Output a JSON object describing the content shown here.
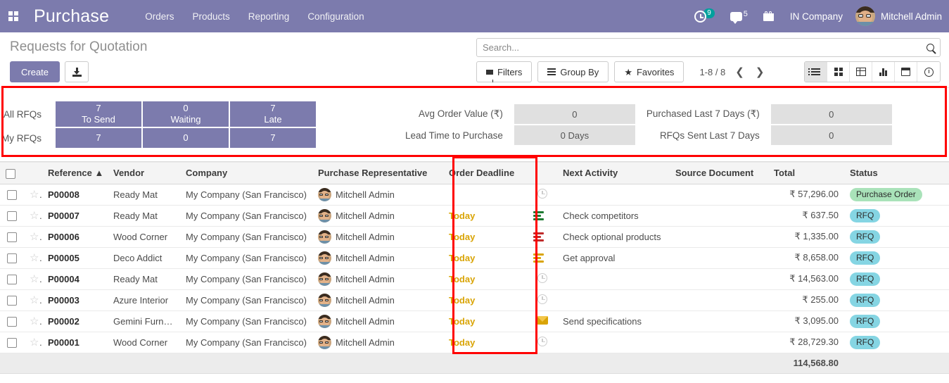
{
  "navbar": {
    "apps_icon": "apps-grid-icon",
    "brand": "Purchase",
    "menu": [
      "Orders",
      "Products",
      "Reporting",
      "Configuration"
    ],
    "activity_icon": "clock-icon",
    "activity_count": "9",
    "messages_icon": "chat-icon",
    "messages_count": "5",
    "gift_icon": "gift-icon",
    "company": "IN Company",
    "user": "Mitchell Admin"
  },
  "control_panel": {
    "title": "Requests for Quotation",
    "create_label": "Create",
    "import_icon": "download-icon",
    "search": {
      "value": "",
      "placeholder": "Search...",
      "icon": "search-icon"
    },
    "filters_label": "Filters",
    "group_by_label": "Group By",
    "favorites_label": "Favorites",
    "pager": "1-8 / 8",
    "prev_icon": "chevron-left-icon",
    "next_icon": "chevron-right-icon",
    "views": [
      {
        "name": "list",
        "icon": "list-view-icon",
        "active": true
      },
      {
        "name": "kanban",
        "icon": "kanban-view-icon",
        "active": false
      },
      {
        "name": "pivot",
        "icon": "pivot-view-icon",
        "active": false
      },
      {
        "name": "graph",
        "icon": "graph-view-icon",
        "active": false
      },
      {
        "name": "calendar",
        "icon": "calendar-view-icon",
        "active": false
      },
      {
        "name": "activity",
        "icon": "activity-view-icon",
        "active": false
      }
    ]
  },
  "dashboard": {
    "row_labels": [
      "All RFQs",
      "My RFQs"
    ],
    "tiles": [
      {
        "caption": "To Send",
        "all": "7",
        "mine": "7"
      },
      {
        "caption": "Waiting",
        "all": "0",
        "mine": "0"
      },
      {
        "caption": "Late",
        "all": "7",
        "mine": "7"
      }
    ],
    "stats": [
      {
        "label": "Avg Order Value (₹)",
        "value": "0"
      },
      {
        "label": "Purchased Last 7 Days (₹)",
        "value": "0"
      },
      {
        "label": "Lead Time to Purchase",
        "value": "0  Days"
      },
      {
        "label": "RFQs Sent Last 7 Days",
        "value": "0"
      }
    ]
  },
  "table": {
    "columns": [
      "Reference",
      "Vendor",
      "Company",
      "Purchase Representative",
      "Order Deadline",
      "Next Activity",
      "Source Document",
      "Total",
      "Status"
    ],
    "sort_column": "Reference",
    "sort_direction": "asc",
    "sort_icon": "sort-asc-icon",
    "rows": [
      {
        "reference": "P00008",
        "vendor": "Ready Mat",
        "company": "My Company (San Francisco)",
        "representative": "Mitchell Admin",
        "deadline": "",
        "activity_icon": "clock-icon",
        "activity_color": "#cccccc",
        "activity": "",
        "source": "",
        "total": "₹ 57,296.00",
        "status": "Purchase Order",
        "status_class": "po"
      },
      {
        "reference": "P00007",
        "vendor": "Ready Mat",
        "company": "My Company (San Francisco)",
        "representative": "Mitchell Admin",
        "deadline": "Today",
        "activity_icon": "tasks-icon",
        "activity_color": "#1e7b33",
        "activity": "Check competitors",
        "source": "",
        "total": "₹ 637.50",
        "status": "RFQ",
        "status_class": "rfq"
      },
      {
        "reference": "P00006",
        "vendor": "Wood Corner",
        "company": "My Company (San Francisco)",
        "representative": "Mitchell Admin",
        "deadline": "Today",
        "activity_icon": "tasks-icon",
        "activity_color": "#c02c2c",
        "activity": "Check optional products",
        "source": "",
        "total": "₹ 1,335.00",
        "status": "RFQ",
        "status_class": "rfq"
      },
      {
        "reference": "P00005",
        "vendor": "Deco Addict",
        "company": "My Company (San Francisco)",
        "representative": "Mitchell Admin",
        "deadline": "Today",
        "activity_icon": "tasks-icon",
        "activity_color": "#d9a406",
        "activity": "Get approval",
        "source": "",
        "total": "₹ 8,658.00",
        "status": "RFQ",
        "status_class": "rfq"
      },
      {
        "reference": "P00004",
        "vendor": "Ready Mat",
        "company": "My Company (San Francisco)",
        "representative": "Mitchell Admin",
        "deadline": "Today",
        "activity_icon": "clock-icon",
        "activity_color": "#cccccc",
        "activity": "",
        "source": "",
        "total": "₹ 14,563.00",
        "status": "RFQ",
        "status_class": "rfq"
      },
      {
        "reference": "P00003",
        "vendor": "Azure Interior",
        "company": "My Company (San Francisco)",
        "representative": "Mitchell Admin",
        "deadline": "Today",
        "activity_icon": "clock-icon",
        "activity_color": "#cccccc",
        "activity": "",
        "source": "",
        "total": "₹ 255.00",
        "status": "RFQ",
        "status_class": "rfq"
      },
      {
        "reference": "P00002",
        "vendor": "Gemini Furniture",
        "company": "My Company (San Francisco)",
        "representative": "Mitchell Admin",
        "deadline": "Today",
        "activity_icon": "envelope-icon",
        "activity_color": "#d9a406",
        "activity": "Send specifications",
        "source": "",
        "total": "₹ 3,095.00",
        "status": "RFQ",
        "status_class": "rfq"
      },
      {
        "reference": "P00001",
        "vendor": "Wood Corner",
        "company": "My Company (San Francisco)",
        "representative": "Mitchell Admin",
        "deadline": "Today",
        "activity_icon": "clock-icon",
        "activity_color": "#cccccc",
        "activity": "",
        "source": "",
        "total": "₹ 28,729.30",
        "status": "RFQ",
        "status_class": "rfq"
      }
    ],
    "footer_total": "114,568.80"
  },
  "annotations": [
    {
      "name": "dashboard-highlight",
      "color": "#ff0000"
    },
    {
      "name": "order-deadline-column-highlight",
      "color": "#ff0000"
    }
  ],
  "colors": {
    "brand_purple": "#7C7BAD",
    "annotation_red": "#ff0000",
    "today_amber": "#d9a406",
    "badge_purchase_order": "#a9e2b9",
    "badge_rfq": "#85d5e3",
    "stat_grey": "#e0e0e0"
  }
}
